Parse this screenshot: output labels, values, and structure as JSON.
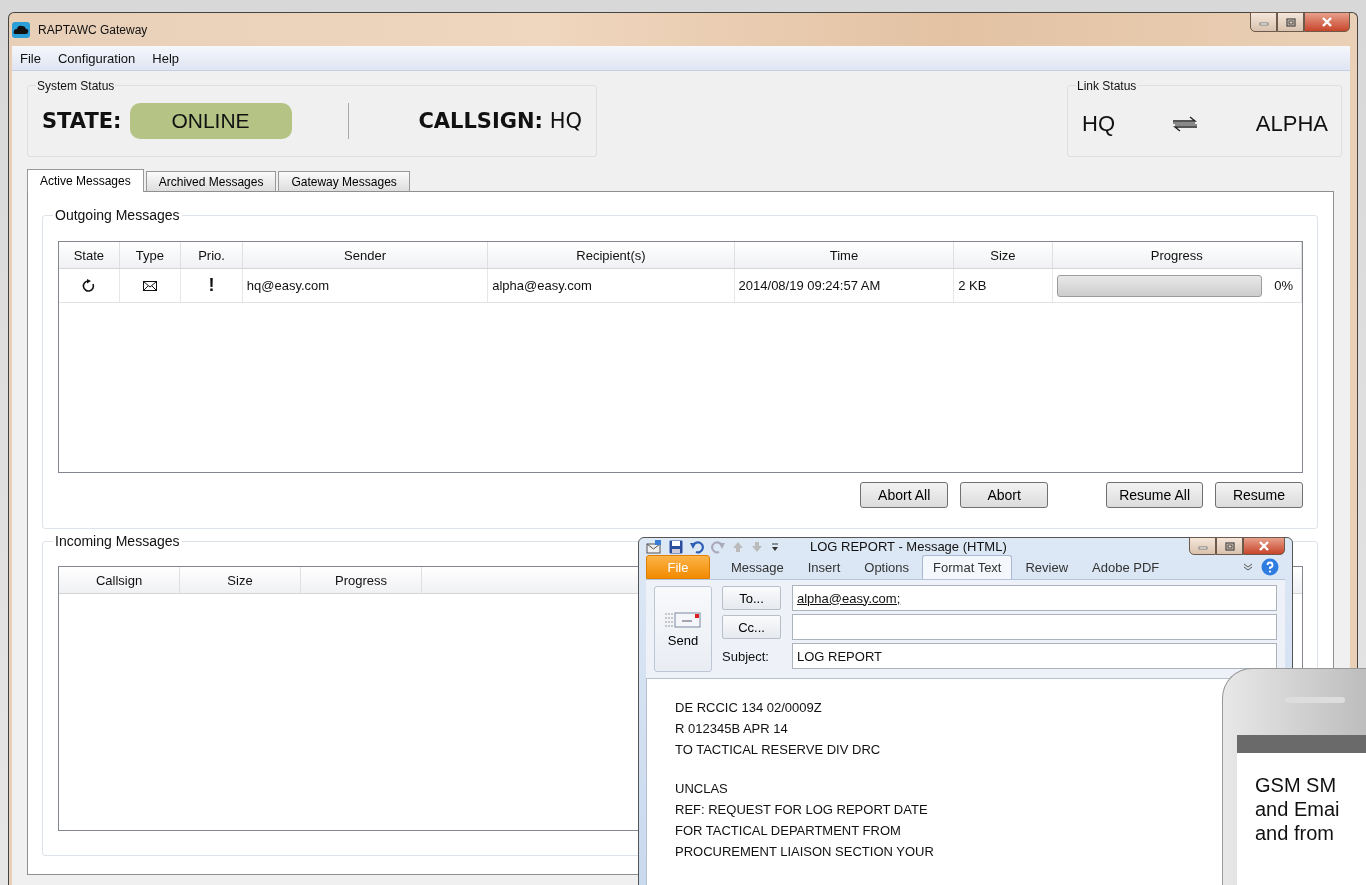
{
  "window": {
    "title": "RAPTAWC Gateway"
  },
  "menu": [
    "File",
    "Configuration",
    "Help"
  ],
  "system_status": {
    "label": "System Status",
    "state_label": "STATE:",
    "state_value": "ONLINE",
    "callsign_label": "CALLSIGN:",
    "callsign_value": "HQ"
  },
  "link_status": {
    "label": "Link Status",
    "from": "HQ",
    "to": "ALPHA"
  },
  "tabs": [
    {
      "label": "Active Messages",
      "selected": true
    },
    {
      "label": "Archived Messages",
      "selected": false
    },
    {
      "label": "Gateway Messages",
      "selected": false
    }
  ],
  "outgoing": {
    "title": "Outgoing Messages",
    "columns": [
      "State",
      "Type",
      "Prio.",
      "Sender",
      "Recipient(s)",
      "Time",
      "Size",
      "Progress"
    ],
    "rows": [
      {
        "priority": "!",
        "sender": "hq@easy.com",
        "recipients": "alpha@easy.com",
        "time": "2014/08/19 09:24:57 AM",
        "size": "2 KB",
        "level": 0,
        "progress_text": "0%"
      }
    ],
    "buttons": [
      "Abort All",
      "Abort",
      "Resume All",
      "Resume"
    ]
  },
  "incoming": {
    "title": "Incoming Messages",
    "columns": [
      "Callsign",
      "Size",
      "Progress"
    ]
  },
  "email_window": {
    "title": "LOG REPORT  -  Message (HTML)",
    "ribbon_tabs": [
      {
        "label": "File",
        "kind": "file",
        "selected": false
      },
      {
        "label": "Message",
        "kind": "tab",
        "selected": false
      },
      {
        "label": "Insert",
        "kind": "tab",
        "selected": false
      },
      {
        "label": "Options",
        "kind": "tab",
        "selected": false
      },
      {
        "label": "Format Text",
        "kind": "tab",
        "selected": true
      },
      {
        "label": "Review",
        "kind": "tab",
        "selected": false
      },
      {
        "label": "Adobe PDF",
        "kind": "tab",
        "selected": false
      }
    ],
    "send": "Send",
    "to_button": "To...",
    "cc_button": "Cc...",
    "to_value": "alpha@easy.com;",
    "subject_label": "Subject:",
    "subject_value": "LOG REPORT",
    "body": [
      {
        "lines": [
          "DE RCCIC 134 02/0009Z",
          "R 012345B APR 14",
          "TO TACTICAL RESERVE DIV DRC"
        ]
      },
      {
        "lines": [
          "UNCLAS",
          "REF: REQUEST FOR LOG REPORT DATE",
          "FOR TACTICAL DEPARTMENT FROM",
          "PROCUREMENT LIAISON SECTION YOUR"
        ]
      }
    ]
  },
  "phone": {
    "lines": [
      "GSM SM",
      "and Emai",
      "and from"
    ]
  }
}
